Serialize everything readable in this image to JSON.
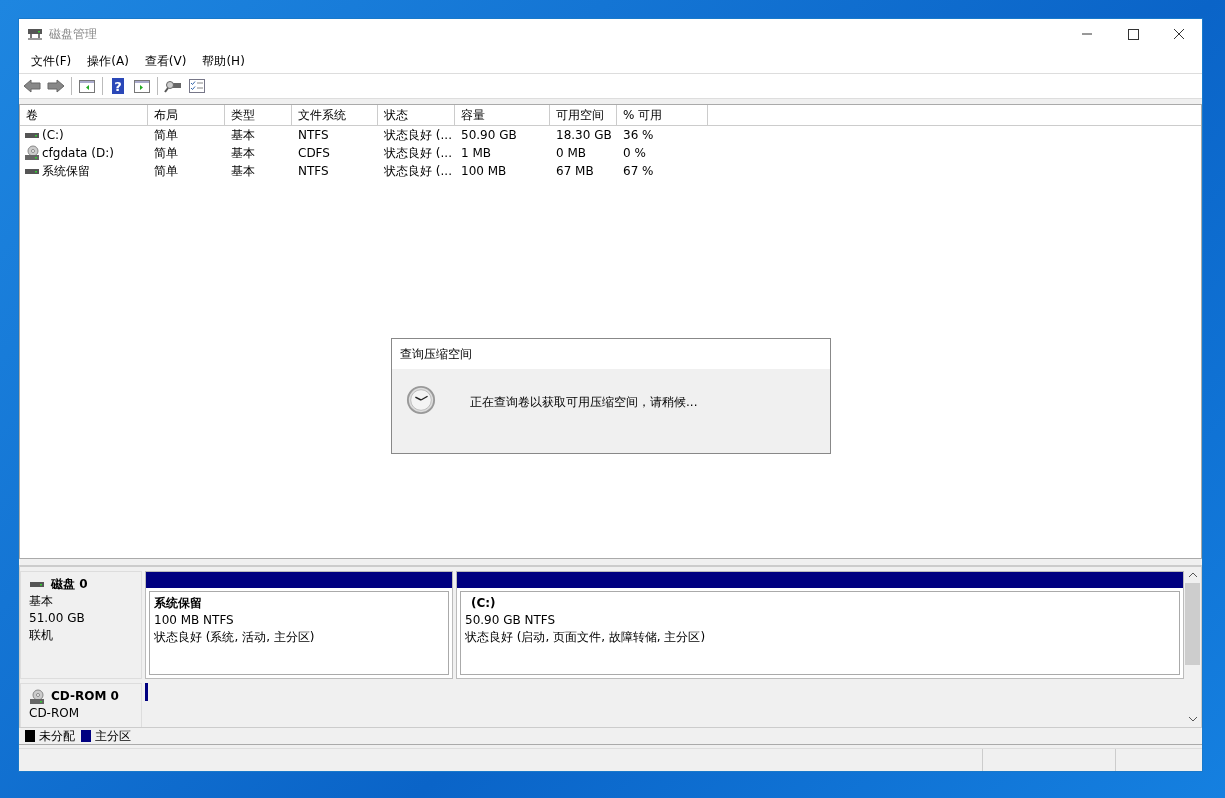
{
  "window": {
    "title": "磁盘管理"
  },
  "menu": [
    "文件(F)",
    "操作(A)",
    "查看(V)",
    "帮助(H)"
  ],
  "toolbar": {
    "help_glyph": "?"
  },
  "volume_table": {
    "columns": [
      "卷",
      "布局",
      "类型",
      "文件系统",
      "状态",
      "容量",
      "可用空间",
      "% 可用"
    ],
    "rows": [
      {
        "kind": "disk",
        "cells": [
          "(C:)",
          "简单",
          "基本",
          "NTFS",
          "状态良好 (...",
          "50.90 GB",
          "18.30 GB",
          "36 %"
        ]
      },
      {
        "kind": "cd",
        "cells": [
          "cfgdata (D:)",
          "简单",
          "基本",
          "CDFS",
          "状态良好 (...",
          "1 MB",
          "0 MB",
          "0 %"
        ]
      },
      {
        "kind": "disk",
        "cells": [
          "系统保留",
          "简单",
          "基本",
          "NTFS",
          "状态良好 (...",
          "100 MB",
          "67 MB",
          "67 %"
        ]
      }
    ]
  },
  "disks": [
    {
      "kind": "disk",
      "name": "磁盘 0",
      "lines": [
        "基本",
        "51.00 GB",
        "联机"
      ],
      "partitions": [
        {
          "name": "系统保留",
          "size": "100 MB NTFS",
          "status": "状态良好 (系统, 活动, 主分区)"
        },
        {
          "name": "(C:)",
          "size": "50.90 GB NTFS",
          "status": "状态良好 (启动, 页面文件, 故障转储, 主分区)"
        }
      ]
    },
    {
      "kind": "cdrom",
      "name": "CD-ROM 0",
      "lines": [
        "CD-ROM"
      ]
    }
  ],
  "legend": [
    {
      "label": "未分配",
      "color": "#000000"
    },
    {
      "label": "主分区",
      "color": "#000080"
    }
  ],
  "dialog": {
    "title": "查询压缩空间",
    "message": "正在查询卷以获取可用压缩空间，请稍候..."
  }
}
